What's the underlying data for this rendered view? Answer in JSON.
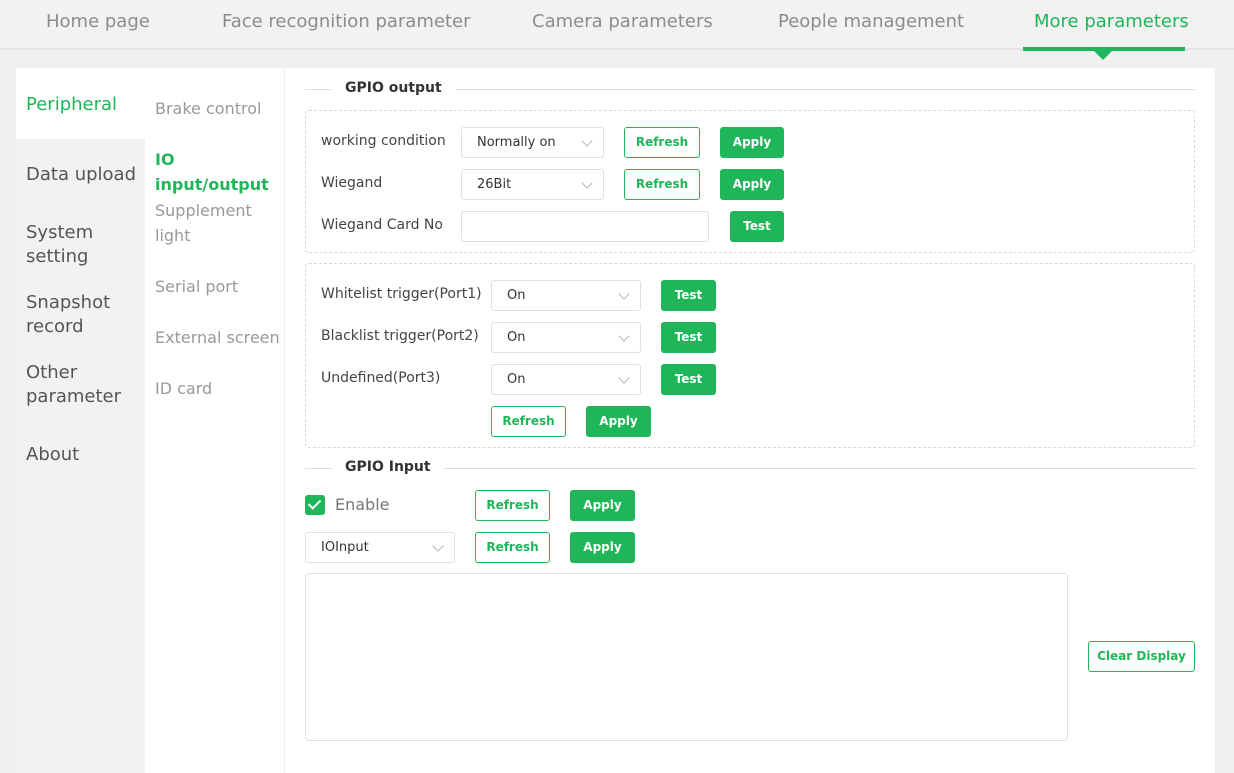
{
  "topnav": {
    "tabs": [
      {
        "label": "Home page"
      },
      {
        "label": "Face recognition parameter"
      },
      {
        "label": "Camera parameters"
      },
      {
        "label": "People management"
      },
      {
        "label": "More parameters",
        "active": true
      }
    ]
  },
  "sidemenu": {
    "items": [
      {
        "label": "Peripheral",
        "active": true
      },
      {
        "label": "Data upload"
      },
      {
        "label": "System setting"
      },
      {
        "label": "Snapshot record"
      },
      {
        "label": "Other parameter"
      },
      {
        "label": "About"
      }
    ]
  },
  "submenu": {
    "items": [
      {
        "label": "Brake control"
      },
      {
        "label": "IO input/output",
        "active": true
      },
      {
        "label": "Supplement light"
      },
      {
        "label": "Serial port"
      },
      {
        "label": "External screen"
      },
      {
        "label": "ID card"
      }
    ]
  },
  "gpio_output": {
    "title": "GPIO output",
    "working_condition": {
      "label": "working condition",
      "value": "Normally on"
    },
    "wiegand": {
      "label": "Wiegand",
      "value": "26Bit"
    },
    "wiegand_card": {
      "label": "Wiegand Card No",
      "value": ""
    },
    "ports": [
      {
        "label": "Whitelist trigger(Port1)",
        "value": "On"
      },
      {
        "label": "Blacklist trigger(Port2)",
        "value": "On"
      },
      {
        "label": "Undefined(Port3)",
        "value": "On"
      }
    ]
  },
  "gpio_input": {
    "title": "GPIO Input",
    "enable_label": "Enable",
    "enabled": true,
    "io_select": "IOInput",
    "log_text": ""
  },
  "buttons": {
    "refresh": "Refresh",
    "apply": "Apply",
    "test": "Test",
    "clear_display": "Clear Display"
  },
  "colors": {
    "accent": "#1fb659"
  }
}
